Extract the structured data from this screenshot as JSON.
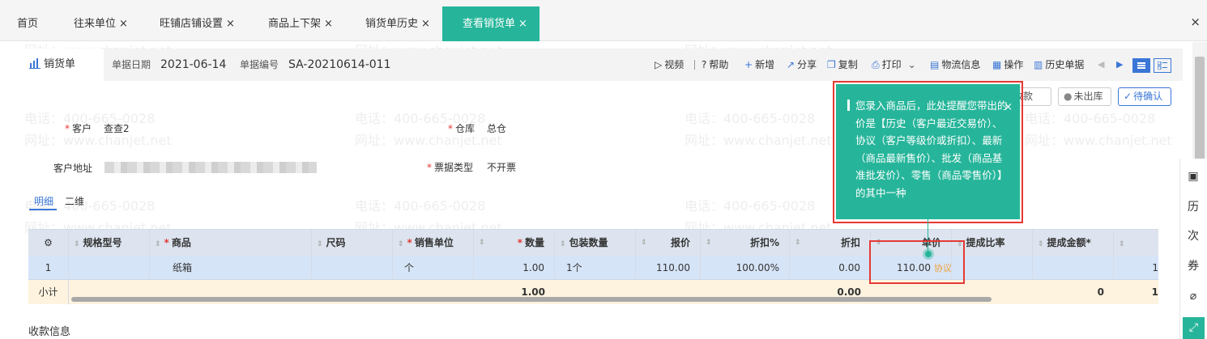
{
  "tabs": [
    {
      "label": "首页",
      "closable": false
    },
    {
      "label": "往来单位",
      "closable": true
    },
    {
      "label": "旺铺店铺设置",
      "closable": true
    },
    {
      "label": "商品上下架",
      "closable": true
    },
    {
      "label": "销货单历史",
      "closable": true
    },
    {
      "label": "查看销货单",
      "closable": true,
      "active": true
    }
  ],
  "close_all_symbol": "×",
  "toolbar": {
    "doc_title": "销货单",
    "date_label": "单据日期",
    "date_value": "2021-06-14",
    "no_label": "单据编号",
    "no_value": "SA-20210614-011",
    "video": "视频",
    "help": "帮助",
    "add": "新增",
    "share": "分享",
    "copy": "复制",
    "print": "打印",
    "logistics": "物流信息",
    "ops": "操作",
    "history": "历史单据"
  },
  "status": {
    "receive": "未收款",
    "outstock": "未出库",
    "confirm": "待确认"
  },
  "form": {
    "customer_label": "客户",
    "customer_value": "查查2",
    "warehouse_label": "仓库",
    "warehouse_value": "总仓",
    "address_label": "客户地址",
    "invoice_label": "票据类型",
    "invoice_value": "不开票"
  },
  "subtabs": {
    "detail": "明细",
    "two_dim": "二维"
  },
  "grid": {
    "headers": {
      "spec": "规格型号",
      "product": "商品",
      "size": "尺码",
      "unit": "销售单位",
      "qty": "数量",
      "pack_qty": "包装数量",
      "quote": "报价",
      "discount_pct": "折扣%",
      "discount": "折扣",
      "price": "单价",
      "commission_rate": "提成比率",
      "commission_amt": "提成金额*"
    },
    "row": {
      "index": "1",
      "product": "纸箱",
      "unit": "个",
      "qty": "1.00",
      "pack_qty": "1个",
      "quote": "110.00",
      "discount_pct": "100.00%",
      "discount": "0.00",
      "price": "110.00",
      "price_tag": "协议",
      "trailing": "1"
    },
    "summary": {
      "label": "小计",
      "qty": "1.00",
      "discount": "0.00",
      "commission_amt": "0",
      "trailing": "1"
    }
  },
  "tooltip": {
    "text": "您录入商品后，此处提醒您带出的价是【历史（客户最近交易价）、协议（客户等级价或折扣）、最新（商品最新售价）、批发（商品基准批发价）、零售（商品零售价）】的其中一种",
    "close": "×"
  },
  "payment_section": "收款信息",
  "watermark": {
    "phone": "电话：400-665-0028",
    "site": "网址：www.chanjet.net"
  },
  "colors": {
    "accent": "#26b59a",
    "link": "#3a76d6",
    "highlight": "#e53935"
  }
}
